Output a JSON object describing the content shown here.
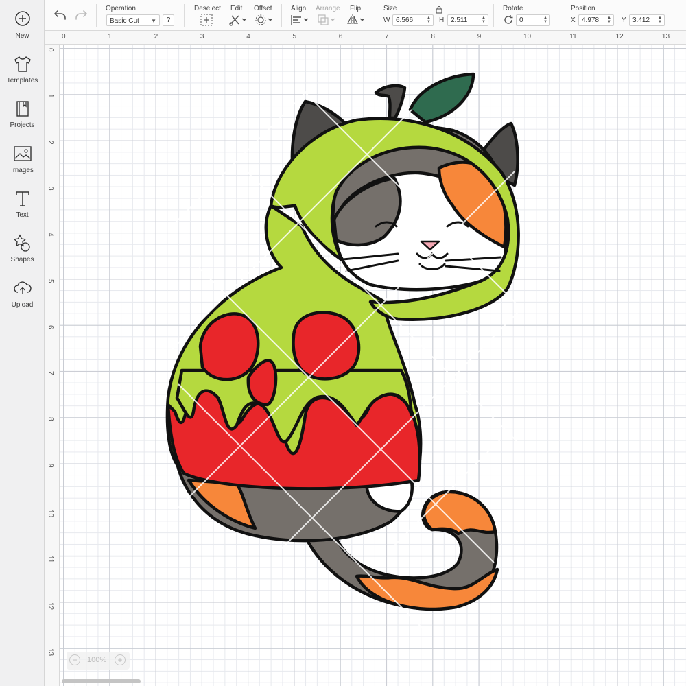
{
  "sidebar": {
    "items": [
      {
        "label": "New",
        "icon": "plus-circle-icon"
      },
      {
        "label": "Templates",
        "icon": "tshirt-icon"
      },
      {
        "label": "Projects",
        "icon": "notebook-icon"
      },
      {
        "label": "Images",
        "icon": "image-icon"
      },
      {
        "label": "Text",
        "icon": "text-t-icon"
      },
      {
        "label": "Shapes",
        "icon": "shapes-icon"
      },
      {
        "label": "Upload",
        "icon": "cloud-upload-icon"
      }
    ]
  },
  "toolbar": {
    "operation": {
      "label": "Operation",
      "value": "Basic Cut",
      "help": "?"
    },
    "deselect": {
      "label": "Deselect"
    },
    "edit": {
      "label": "Edit"
    },
    "offset": {
      "label": "Offset"
    },
    "align": {
      "label": "Align"
    },
    "arrange": {
      "label": "Arrange"
    },
    "flip": {
      "label": "Flip"
    },
    "size": {
      "label": "Size",
      "w_label": "W",
      "w_value": "6.566",
      "h_label": "H",
      "h_value": "2.511"
    },
    "rotate": {
      "label": "Rotate",
      "value": "0"
    },
    "position": {
      "label": "Position",
      "x_label": "X",
      "x_value": "4.978",
      "y_label": "Y",
      "y_value": "3.412"
    }
  },
  "ruler": {
    "top": [
      "0",
      "1",
      "2",
      "3",
      "4",
      "5",
      "6",
      "7",
      "8",
      "9",
      "10",
      "11",
      "12",
      "13"
    ],
    "left": [
      "0",
      "1",
      "2",
      "3",
      "4",
      "5",
      "6",
      "7",
      "8",
      "9",
      "10",
      "11",
      "12",
      "13"
    ]
  },
  "zoom": {
    "minus": "−",
    "value": "100%",
    "plus": "+"
  },
  "colors": {
    "hood_green": "#b5d93f",
    "apple_red": "#e8262a",
    "cat_orange": "#f7873a",
    "cat_gray": "#75706b",
    "ear_dark": "#4d4b49",
    "leaf": "#2f6b4f"
  }
}
